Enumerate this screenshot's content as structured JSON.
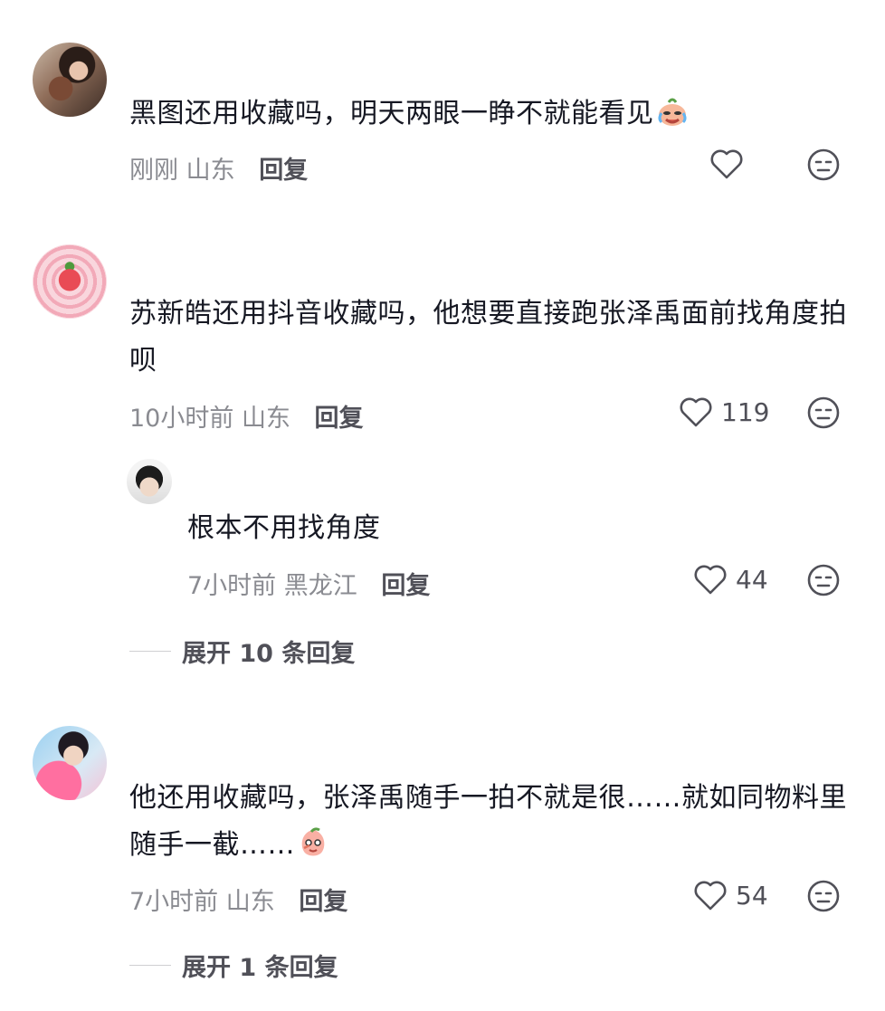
{
  "comments": [
    {
      "text": "黑图还用收藏吗，明天两眼一睁不就能看见",
      "emoji": "crying-laughing-emoji",
      "time": "刚刚",
      "location": "山东",
      "reply_label": "回复",
      "likes": ""
    },
    {
      "text": "苏新皓还用抖音收藏吗，他想要直接跑张泽禹面前找角度拍呗",
      "time": "10小时前",
      "location": "山东",
      "reply_label": "回复",
      "likes": "119",
      "replies": [
        {
          "text": "根本不用找角度",
          "time": "7小时前",
          "location": "黑龙江",
          "reply_label": "回复",
          "likes": "44"
        }
      ],
      "expand_label": "展开 10 条回复"
    },
    {
      "text": "他还用收藏吗，张泽禹随手一拍不就是很……就如同物料里随手一截……",
      "emoji": "smirk-peach-emoji",
      "time": "7小时前",
      "location": "山东",
      "reply_label": "回复",
      "likes": "54",
      "expand_label": "展开 1 条回复"
    }
  ],
  "colors": {
    "text": "#161823",
    "meta": "#8a8b91",
    "action": "#505058"
  }
}
